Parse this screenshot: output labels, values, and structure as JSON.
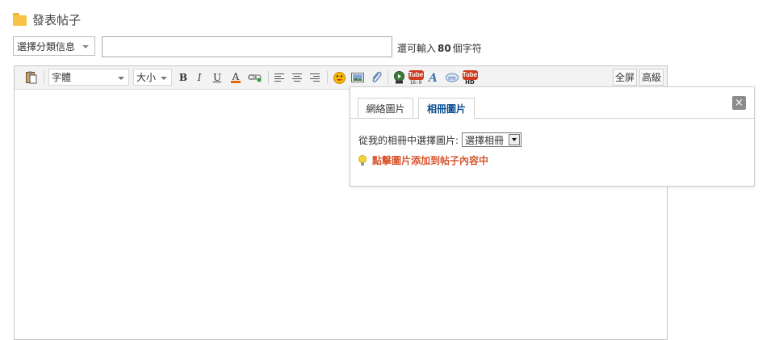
{
  "page": {
    "title": "發表帖子"
  },
  "form": {
    "category_select": "選擇分類信息",
    "title_value": "",
    "char_hint_prefix": "還可輸入",
    "char_hint_count": "80",
    "char_hint_suffix": "個字符"
  },
  "toolbar": {
    "font_label": "字體",
    "size_label": "大小",
    "bold": "B",
    "italic": "I",
    "underline": "U",
    "font_color": "A",
    "fullscreen": "全屏",
    "advanced": "高級",
    "youtube_label": "Tube",
    "youtube_169": "16:9",
    "youtube_hd": "HD",
    "accent_red": "#cc3b1f",
    "icons": [
      "paste-icon",
      "font-color-icon",
      "link-icon",
      "align-left-icon",
      "align-center-icon",
      "align-right-icon",
      "emoticon-icon",
      "image-icon",
      "attach-icon",
      "media-icon",
      "youtube-icon",
      "youtube-wide-icon",
      "flash-icon",
      "quote-icon",
      "youtube-hd-icon"
    ]
  },
  "image_popup": {
    "tabs": [
      "網絡圖片",
      "相冊圖片"
    ],
    "active_tab": "相冊圖片",
    "album_label": "從我的相冊中選擇圖片:",
    "album_select": "選擇相冊",
    "tip": "點擊圖片添加到帖子內容中",
    "tip_color": "#d9552f",
    "close": "×"
  }
}
